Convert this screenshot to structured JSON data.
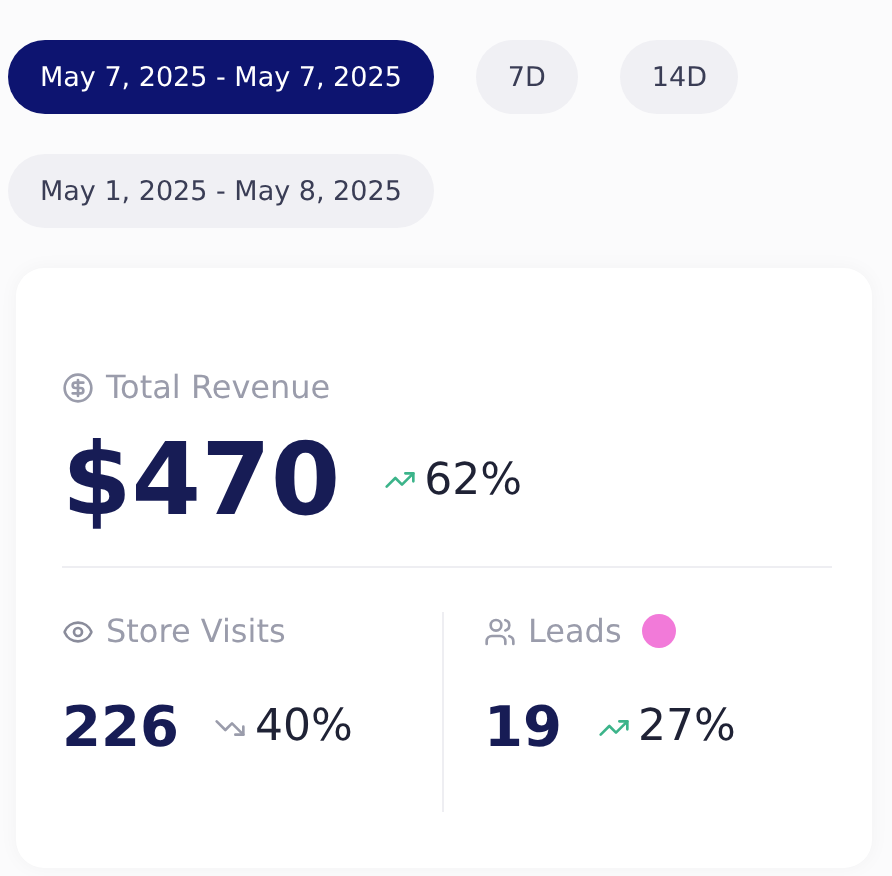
{
  "date_ranges": [
    {
      "label": "May 7, 2025 - May 7, 2025",
      "selected": true
    },
    {
      "label": "7D",
      "selected": false
    },
    {
      "label": "14D",
      "selected": false
    }
  ],
  "custom_range": {
    "label": "May 1, 2025 - May 8, 2025",
    "selected": false
  },
  "revenue": {
    "label": "Total Revenue",
    "value": "$470",
    "trend": {
      "kind": "up",
      "text": "62%"
    }
  },
  "metrics": [
    {
      "kind": "eye",
      "label": "Store Visits",
      "value": "226",
      "trend": {
        "kind": "down",
        "text": "40%"
      }
    },
    {
      "kind": "users",
      "label": "Leads",
      "color": "#f27ad9",
      "value": "19",
      "trend": {
        "kind": "up",
        "text": "27%"
      }
    }
  ]
}
